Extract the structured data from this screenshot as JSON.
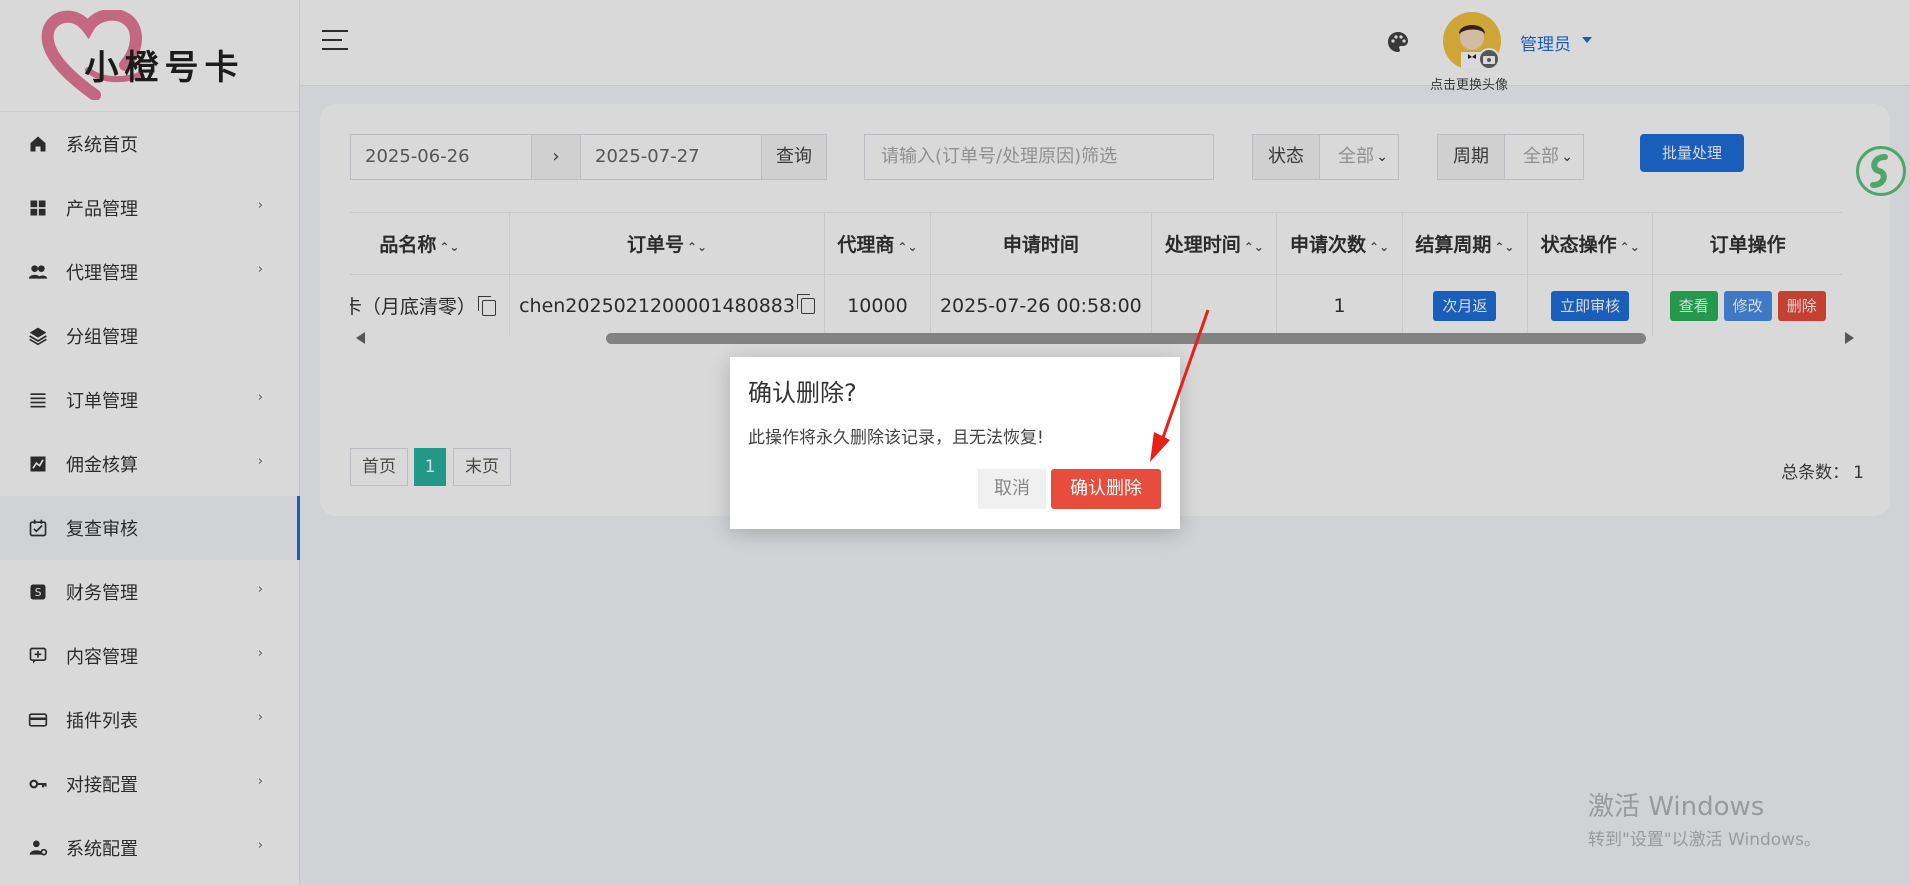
{
  "logo": {
    "text": "小橙号卡"
  },
  "sidebar": {
    "items": [
      {
        "label": "系统首页",
        "icon": "home-icon",
        "has_sub": false
      },
      {
        "label": "产品管理",
        "icon": "grid-icon",
        "has_sub": true
      },
      {
        "label": "代理管理",
        "icon": "users-icon",
        "has_sub": true
      },
      {
        "label": "分组管理",
        "icon": "layers-icon",
        "has_sub": false
      },
      {
        "label": "订单管理",
        "icon": "list-icon",
        "has_sub": true
      },
      {
        "label": "佣金核算",
        "icon": "chart-icon",
        "has_sub": true
      },
      {
        "label": "复查审核",
        "icon": "review-icon",
        "has_sub": false,
        "active": true
      },
      {
        "label": "财务管理",
        "icon": "dollar-icon",
        "has_sub": true
      },
      {
        "label": "内容管理",
        "icon": "content-icon",
        "has_sub": true
      },
      {
        "label": "插件列表",
        "icon": "card-icon",
        "has_sub": true
      },
      {
        "label": "对接配置",
        "icon": "key-icon",
        "has_sub": true
      },
      {
        "label": "系统配置",
        "icon": "user-gear-icon",
        "has_sub": true
      }
    ],
    "chevron": "›"
  },
  "header": {
    "avatar_caption": "点击更换头像",
    "user_name": "管理员"
  },
  "filters": {
    "date_start": "2025-06-26",
    "date_sep": "›",
    "date_end": "2025-07-27",
    "query_label": "查询",
    "search_placeholder": "请输入(订单号/处理原因)筛选",
    "status_label": "状态",
    "status_value": "全部",
    "period_label": "周期",
    "period_value": "全部",
    "batch_label": "批量处理"
  },
  "table": {
    "headers": [
      "品名称",
      "订单号",
      "代理商",
      "申请时间",
      "处理时间",
      "申请次数",
      "结算周期",
      "状态操作",
      "订单操作"
    ],
    "row": {
      "product": "卡（月底清零）",
      "order_no": "chen2025021200001480883",
      "agent": "10000",
      "apply_time": "2025-07-26 00:58:00",
      "process_time": "",
      "apply_count": "1",
      "period_btn": "次月返",
      "status_btn": "立即审核",
      "view_btn": "查看",
      "edit_btn": "修改",
      "delete_btn": "删除"
    }
  },
  "pager": {
    "first": "首页",
    "current": "1",
    "last": "末页",
    "total_label": "总条数：",
    "total_value": "1"
  },
  "modal": {
    "title": "确认删除?",
    "body": "此操作将永久删除该记录，且无法恢复!",
    "cancel": "取消",
    "confirm": "确认删除"
  },
  "watermark": {
    "title": "激活 Windows",
    "sub": "转到\"设置\"以激活 Windows。"
  },
  "colors": {
    "accent": "#1e6fdb",
    "danger": "#e74c3c",
    "success": "#2bb35b",
    "pager_active": "#2bb3a0"
  }
}
